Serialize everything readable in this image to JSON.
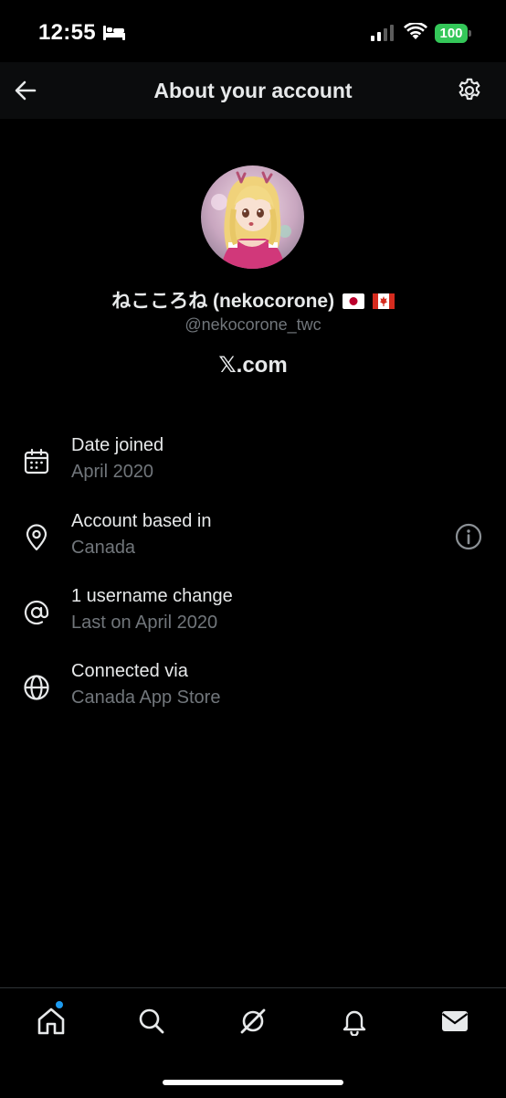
{
  "status_bar": {
    "time": "12:55",
    "battery": "100",
    "icons": [
      "bed-icon",
      "cellular-signal-icon",
      "wifi-icon",
      "battery-icon"
    ],
    "battery_color": "#34c759"
  },
  "header": {
    "title": "About your account",
    "back_icon": "arrow-left-icon",
    "settings_icon": "gear-icon"
  },
  "profile": {
    "display_name": "ねこころね (nekocorone)",
    "flags": [
      "japan-flag",
      "canada-flag"
    ],
    "handle": "@nekocorone_twc",
    "site": "𝕏.com"
  },
  "info_rows": [
    {
      "title": "Date joined",
      "value": "April 2020",
      "icon": "calendar-icon"
    },
    {
      "title": "Account based in",
      "value": "Canada",
      "icon": "location-pin-icon",
      "trailing_icon": "info-icon"
    },
    {
      "title": "1 username change",
      "value": "Last on April 2020",
      "icon": "at-sign-icon"
    },
    {
      "title": "Connected via",
      "value": "Canada App Store",
      "icon": "globe-icon"
    }
  ],
  "bottom_nav": {
    "items": [
      "home-icon",
      "search-icon",
      "grok-icon",
      "notifications-bell-icon",
      "messages-envelope-icon"
    ],
    "active": "home-icon",
    "badge_color": "#1d9bf0"
  },
  "colors": {
    "background": "#000000",
    "primary_text": "#e7e9ea",
    "secondary_text": "#71767b",
    "header_background": "#0b0c0d"
  }
}
